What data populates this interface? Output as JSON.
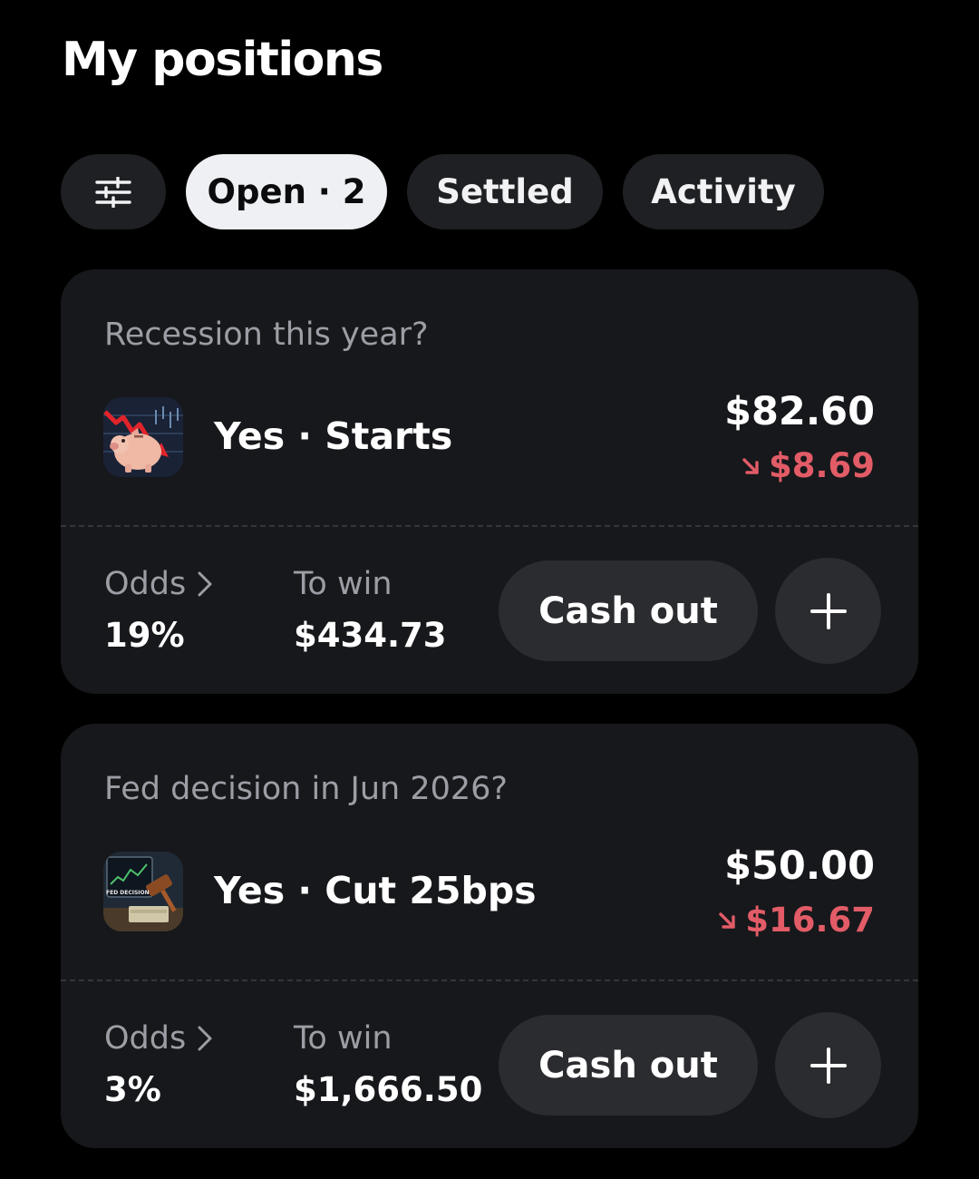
{
  "page": {
    "title": "My positions"
  },
  "tabs": {
    "filter_icon": "sliders-icon",
    "items": [
      {
        "label": "Open · 2",
        "active": true
      },
      {
        "label": "Settled",
        "active": false
      },
      {
        "label": "Activity",
        "active": false
      }
    ]
  },
  "positions": [
    {
      "question": "Recession this year?",
      "thumbnail": "piggy-bank-chart-down",
      "pick": "Yes · Starts",
      "value": "$82.60",
      "change": "$8.69",
      "change_direction": "down",
      "odds_label": "Odds",
      "odds": "19%",
      "to_win_label": "To win",
      "to_win": "$434.73",
      "cashout_label": "Cash out"
    },
    {
      "question": "Fed decision in Jun 2026?",
      "thumbnail": "fed-decision-gavel",
      "thumbnail_text": "FED DECISION",
      "pick": "Yes · Cut 25bps",
      "value": "$50.00",
      "change": "$16.67",
      "change_direction": "down",
      "odds_label": "Odds",
      "odds": "3%",
      "to_win_label": "To win",
      "to_win": "$1,666.50",
      "cashout_label": "Cash out"
    }
  ],
  "colors": {
    "background": "#000000",
    "card": "#17181b",
    "pill": "#1f2023",
    "active_pill": "#eef0f3",
    "negative": "#e25c67",
    "muted_text": "#9c9ea5"
  }
}
